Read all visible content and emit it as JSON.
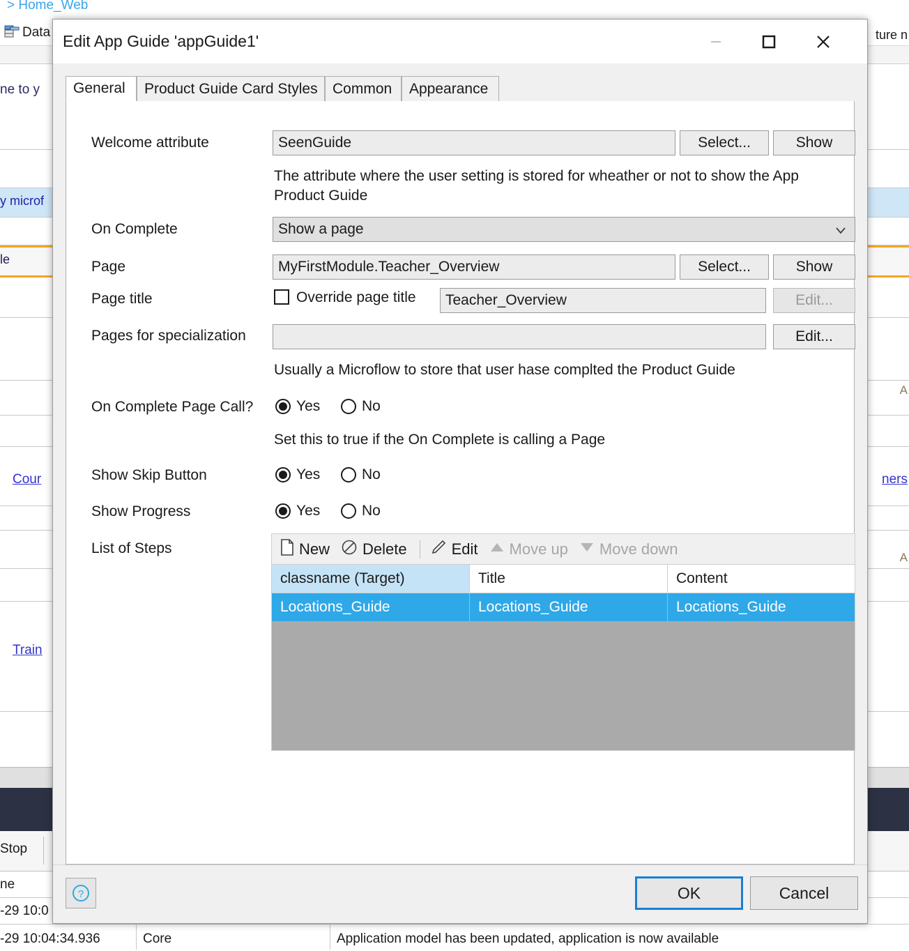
{
  "background": {
    "breadcrumb": "> Home_Web",
    "tab_label": "Data",
    "tab_icon": "database-icon",
    "header_right": "ture n",
    "welcome_text": "ne to y",
    "row_microflow": "y microf",
    "row_le": "le",
    "link_courses": "Cour",
    "link_trainers": "ners",
    "link_training": "Train",
    "muted_a1": "A",
    "muted_a2": "A",
    "stop_label": "Stop",
    "log_col_time_label": "ne",
    "log_rows": [
      {
        "time": "-29 10:0",
        "module": "",
        "message": ""
      },
      {
        "time": "-29 10:04:34.936",
        "module": "Core",
        "message": "Application model has been updated, application is now available"
      }
    ]
  },
  "dialog": {
    "title": "Edit App Guide 'appGuide1'",
    "window_buttons": {
      "minimize": "minimize-icon",
      "maximize": "maximize-icon",
      "close": "close-icon"
    },
    "tabs": [
      {
        "label": "General",
        "active": true
      },
      {
        "label": "Product Guide Card Styles",
        "active": false
      },
      {
        "label": "Common",
        "active": false
      },
      {
        "label": "Appearance",
        "active": false
      }
    ],
    "fields": {
      "welcome_attribute": {
        "label": "Welcome attribute",
        "value": "SeenGuide",
        "select_button": "Select...",
        "show_button": "Show",
        "help": "The attribute where the user setting is stored for wheather or not to show the App Product Guide"
      },
      "on_complete": {
        "label": "On Complete",
        "value": "Show a page",
        "chevron": "chevron-down-icon"
      },
      "page": {
        "label": "Page",
        "value": "MyFirstModule.Teacher_Overview",
        "select_button": "Select...",
        "show_button": "Show"
      },
      "page_title": {
        "label": "Page title",
        "checkbox_label": "Override page title",
        "checked": false,
        "value": "Teacher_Overview",
        "edit_button": "Edit...",
        "edit_disabled": true
      },
      "pages_for_specialization": {
        "label": "Pages for specialization",
        "value": "",
        "edit_button": "Edit...",
        "help": "Usually a Microflow to store that user hase complted the Product Guide"
      },
      "on_complete_page_call": {
        "label": "On Complete Page Call?",
        "yes_label": "Yes",
        "no_label": "No",
        "selected": "Yes",
        "help": "Set this to true if the On Complete is calling a Page"
      },
      "show_skip_button": {
        "label": "Show Skip Button",
        "yes_label": "Yes",
        "no_label": "No",
        "selected": "Yes"
      },
      "show_progress": {
        "label": "Show Progress",
        "yes_label": "Yes",
        "no_label": "No",
        "selected": "Yes"
      },
      "list_of_steps": {
        "label": "List of Steps"
      }
    },
    "grid": {
      "toolbar": [
        {
          "label": "New",
          "icon": "new-document-icon",
          "disabled": false
        },
        {
          "label": "Delete",
          "icon": "delete-icon",
          "disabled": false
        },
        {
          "label": "Edit",
          "icon": "pencil-icon",
          "disabled": false
        },
        {
          "label": "Move up",
          "icon": "triangle-up-icon",
          "disabled": true
        },
        {
          "label": "Move down",
          "icon": "triangle-down-icon",
          "disabled": true
        }
      ],
      "columns": [
        "classname (Target)",
        "Title",
        "Content"
      ],
      "rows": [
        [
          "Locations_Guide",
          "Locations_Guide",
          "Locations_Guide"
        ]
      ]
    },
    "footer": {
      "help_icon": "help-circle-icon",
      "ok_label": "OK",
      "cancel_label": "Cancel"
    }
  },
  "colors": {
    "accent_blue": "#2fa8e8",
    "selected_header": "#c5e3f6",
    "focus_border": "#1a7fd4",
    "orange_rule": "#f5a623",
    "dark_bar": "#2c3244"
  }
}
